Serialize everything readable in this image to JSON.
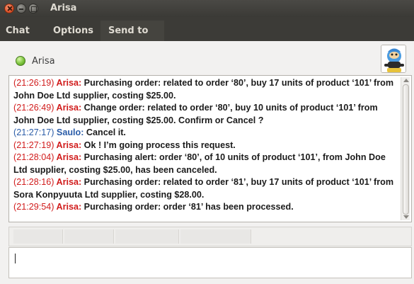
{
  "window": {
    "title": "Arisa"
  },
  "menu": {
    "chat": "Chat",
    "options": "Options",
    "send_to": "Send to"
  },
  "contact": {
    "name": "Arisa",
    "status_color": "#7cc43d"
  },
  "colors": {
    "agent": "#d11c1c",
    "user": "#2a5ca8"
  },
  "messages": [
    {
      "time": "(21:26:19)",
      "sender": "Arisa:",
      "text": "Purchasing order: related to order ‘80’, buy 17 units of product ‘101’ from John Doe Ltd supplier, costing $25.00.",
      "role": "agent"
    },
    {
      "time": "(21:26:49)",
      "sender": "Arisa:",
      "text": "Change order: related to order ‘80’, buy 10 units of product ‘101’ from John Doe Ltd supplier, costing $25.00. Confirm or Cancel ?",
      "role": "agent"
    },
    {
      "time": "(21:27:17)",
      "sender": "Saulo:",
      "text": "Cancel it.",
      "role": "user"
    },
    {
      "time": "(21:27:19)",
      "sender": "Arisa:",
      "text": "Ok ! I’m going process this request.",
      "role": "agent"
    },
    {
      "time": "(21:28:04)",
      "sender": "Arisa:",
      "text": "Purchasing alert: order ‘80’, of 10 units of product ‘101’, from John Doe Ltd supplier, costing $25.00, has been canceled.",
      "role": "agent"
    },
    {
      "time": "(21:28:16)",
      "sender": "Arisa:",
      "text": "Purchasing order: related to order ‘81’, buy 17 units of product ‘101’ from Sora Konpyuuta Ltd supplier, costing $28.00.",
      "role": "agent"
    },
    {
      "time": "(21:29:54)",
      "sender": "Arisa:",
      "text": "Purchasing order: order ‘81’ has been processed.",
      "role": "agent"
    }
  ],
  "input": {
    "value": ""
  }
}
